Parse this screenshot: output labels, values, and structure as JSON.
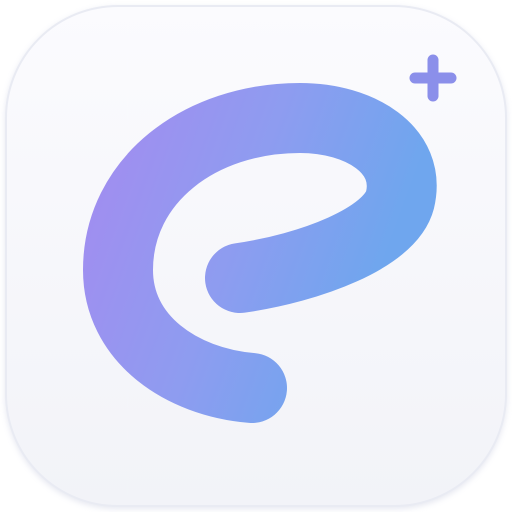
{
  "icon": {
    "name": "app-icon",
    "glyph": "e-swirl-icon",
    "badge": "plus-icon",
    "colors": {
      "tile_top": "#fbfbfe",
      "tile_bottom": "#f2f3f8",
      "tile_edge": "#e9ebf3",
      "glyph_start": "#a08ef0",
      "glyph_mid": "#8e9cf0",
      "glyph_end": "#6fa6ee",
      "badge": "#8b8fea"
    }
  }
}
